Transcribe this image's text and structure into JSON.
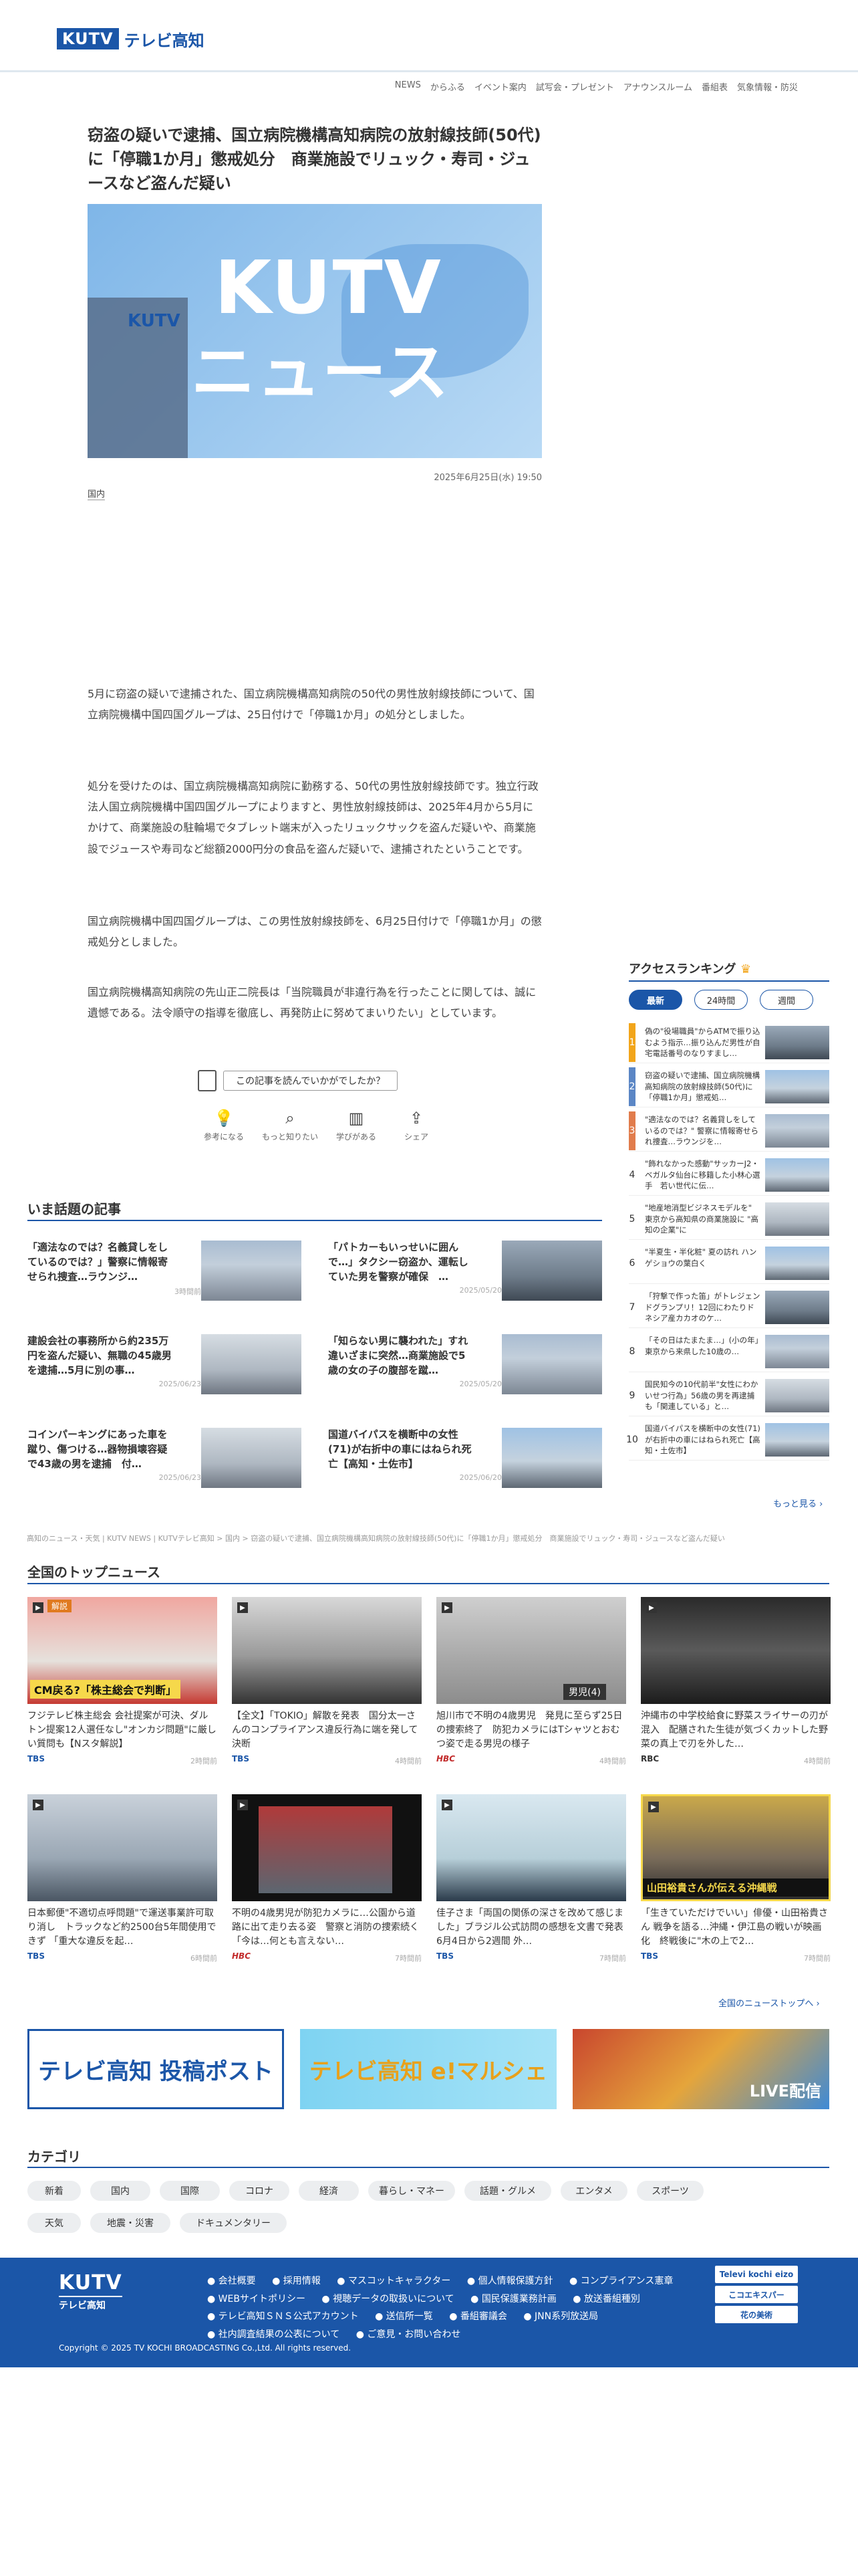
{
  "header": {
    "logo_mark": "KUTV",
    "logo_text": "テレビ高知"
  },
  "nav": [
    "NEWS",
    "からふる",
    "イベント案内",
    "試写会・プレゼント",
    "アナウンスルーム",
    "番組表",
    "気象情報・防災"
  ],
  "article": {
    "title": "窃盗の疑いで逮捕、国立病院機構高知病院の放射線技師(50代)に「停職1か月」懲戒処分　商業施設でリュック・寿司・ジュースなど盗んだ疑い",
    "hero_title": "KUTV",
    "hero_sub": "ニュース",
    "hero_mark": "KUTV",
    "date": "2025年6月25日(水) 19:50",
    "category": "国内",
    "paragraphs": [
      "5月に窃盗の疑いで逮捕された、国立病院機構高知病院の50代の男性放射線技師について、国立病院機構中国四国グループは、25日付けで「停職1か月」の処分としました。",
      "処分を受けたのは、国立病院機構高知病院に勤務する、50代の男性放射線技師です。独立行政法人国立病院機構中国四国グループによりますと、男性放射線技師は、2025年4月から5月にかけて、商業施設の駐輪場でタブレット端末が入ったリュックサックを盗んだ疑いや、商業施設でジュースや寿司など総額2000円分の食品を盗んだ疑いで、逮捕されたということです。",
      "国立病院機構中国四国グループは、この男性放射線技師を、6月25日付けで「停職1か月」の懲戒処分としました。",
      "国立病院機構高知病院の先山正二院長は「当院職員が非違行為を行ったことに関しては、誠に遺憾である。法令順守の指導を徹底し、再発防止に努めてまいりたい」としています。"
    ],
    "feedback_prompt": "この記事を読んでいかがでしたか？",
    "reactions": [
      "参考になる",
      "もっと知りたい",
      "学びがある",
      "シェア"
    ]
  },
  "trending": {
    "title": "いま話題の記事",
    "items": [
      {
        "title": "「適法なのでは？名義貸しをしているのでは？」警察に情報寄せられ捜査…ラウンジ…",
        "date": "3時間前"
      },
      {
        "title": "「パトカーもいっせいに囲んで…」タクシー窃盗か、運転していた男を警察が確保　…",
        "date": "2025/05/20"
      },
      {
        "title": "建設会社の事務所から約235万円を盗んだ疑い、無職の45歳男を逮捕…5月に別の事…",
        "date": "2025/06/23"
      },
      {
        "title": "「知らない男に襲われた」すれ違いざまに突然…商業施設で5歳の女の子の腹部を蹴…",
        "date": "2025/05/20"
      },
      {
        "title": "コインパーキングにあった車を蹴り、傷つける…器物損壊容疑で43歳の男を逮捕　付…",
        "date": "2025/06/23"
      },
      {
        "title": "国道バイパスを横断中の女性(71)が右折中の車にはねられ死亡【高知・土佐市】",
        "date": "2025/06/20"
      }
    ]
  },
  "ranking": {
    "title": "アクセスランキング",
    "tabs": [
      "最新",
      "24時間",
      "週間"
    ],
    "items": [
      {
        "no": "1",
        "title": "偽の\"役場職員\"からATMで振り込むよう指示…振り込んだ男性が自宅電話番号のなりすまし…"
      },
      {
        "no": "2",
        "title": "窃盗の疑いで逮捕、国立病院機構高知病院の放射線技師(50代)に「停職1か月」懲戒処…"
      },
      {
        "no": "3",
        "title": "\"適法なのでは？名義貸しをしているのでは？\" 警察に情報寄せられ捜査…ラウンジを…"
      },
      {
        "no": "4",
        "title": "\"飾れなかった感動\"サッカーJ2・ベガルタ仙台に移籍した小林心選手　若い世代に伝…"
      },
      {
        "no": "5",
        "title": "\"地産地消型ビジネスモデルを\" 東京から高知県の商業施設に \"高知の企業\"に"
      },
      {
        "no": "6",
        "title": "\"半夏生・半化粧\" 夏の訪れ ハンゲショウの葉白く"
      },
      {
        "no": "7",
        "title": "「狩撃で作った笛」がトレジェンドグランプリ！12回にわたりドネシア産カカオのケ…"
      },
      {
        "no": "8",
        "title": "「その日はたまたま…」(小の年」東京から来県した10歳の…"
      },
      {
        "no": "9",
        "title": "国民知今の10代前半\"女性にわかいせつ行為」56歳の男を再逮捕も「関連している」と…"
      },
      {
        "no": "10",
        "title": "国道バイパスを横断中の女性(71)が右折中の車にはねられ死亡【高知・土佐市】"
      }
    ],
    "more": "もっと見る ›"
  },
  "breadcrumb": "高知のニュース・天気 | KUTV NEWS | KUTVテレビ高知 > 国内 > 窃盗の疑いで逮捕、国立病院機構高知病院の放射線技師(50代)に「停職1か月」懲戒処分　商業施設でリュック・寿司・ジュースなど盗んだ疑い",
  "top_news": {
    "title": "全国のトップニュース",
    "items": [
      {
        "title": "フジテレビ株主総会 会社提案が可決、ダルトン提案12人選任なし\"オンカジ問題\"に厳しい質問も【Nスタ解説】",
        "source": "TBS",
        "time": "2時間前",
        "thumb_text": "CM戻る?「株主総会で判断」",
        "thumb_tag": "解説"
      },
      {
        "title": "【全文】「TOKIO」解散を発表　国分太一さんのコンプライアンス違反行為に端を発して決断",
        "source": "TBS",
        "time": "4時間前",
        "thumb_text": "",
        "thumb_tag": ""
      },
      {
        "title": "旭川市で不明の4歳男児　発見に至らず25日の捜索終了　防犯カメラにはTシャツとおむつ姿で走る男児の様子",
        "source": "HBC",
        "time": "4時間前",
        "thumb_text": "男児(4)",
        "thumb_tag": ""
      },
      {
        "title": "沖縄市の中学校給食に野菜スライサーの刃が混入　配膳された生徒が気づくカットした野菜の真上で刃を外した…",
        "source": "RBC",
        "time": "4時間前",
        "thumb_text": "",
        "thumb_tag": ""
      },
      {
        "title": "日本郵便\"不適切点呼問題\"で運送事業許可取り消し　トラックなど約2500台5年間使用できず 「重大な違反を起…",
        "source": "TBS",
        "time": "6時間前",
        "thumb_text": "",
        "thumb_tag": ""
      },
      {
        "title": "不明の4歳男児が防犯カメラに…公園から道路に出て走り去る姿　警察と消防の捜索続く「今は…何とも言えない…",
        "source": "HBC",
        "time": "7時間前",
        "thumb_text": "",
        "thumb_tag": ""
      },
      {
        "title": "佳子さま「両国の関係の深さを改めて感じました」ブラジル公式訪問の感想を文書で発表　6月4日から2週間 外…",
        "source": "TBS",
        "time": "7時間前",
        "thumb_text": "",
        "thumb_tag": ""
      },
      {
        "title": "「生きていただけでいい」俳優・山田裕貴さん 戦争を語る…沖縄・伊江島の戦いが映画化　終戦後に\"木の上で2…",
        "source": "TBS",
        "time": "7時間前",
        "thumb_text": "山田裕貴さんが伝える沖縄戦",
        "thumb_tag": ""
      }
    ],
    "more": "全国のニューストップへ ›"
  },
  "banners": [
    "テレビ高知 投稿ポスト",
    "テレビ高知 e!マルシェ",
    "LIVE配信"
  ],
  "categories": {
    "title": "カテゴリ",
    "items": [
      "新着",
      "国内",
      "国際",
      "コロナ",
      "経済",
      "暮らし・マネー",
      "話題・グルメ",
      "エンタメ",
      "スポーツ",
      "天気",
      "地震・災害",
      "ドキュメンタリー"
    ]
  },
  "footer": {
    "logo_a": "KUTV",
    "logo_b": "テレビ高知",
    "links": [
      "会社概要",
      "採用情報",
      "マスコットキャラクター",
      "個人情報保護方針",
      "コンプライアンス憲章",
      "WEBサイトポリシー",
      "視聴データの取扱いについて",
      "国民保護業務計画",
      "放送番組種別",
      "テレビ高知ＳＮＳ公式アカウント",
      "送信所一覧",
      "番組審議会",
      "JNN系列放送局",
      "社内調査結果の公表について",
      "ご意見・お問い合わせ"
    ],
    "badges": [
      "Televi kochi eizo",
      "こコエキスパー",
      "花の美術"
    ],
    "copyright": "Copyright © 2025 TV KOCHI BROADCASTING Co.,Ltd. All rights reserved."
  },
  "colors": {
    "brand": "#1b56a8",
    "accent": "#f2a51a"
  }
}
